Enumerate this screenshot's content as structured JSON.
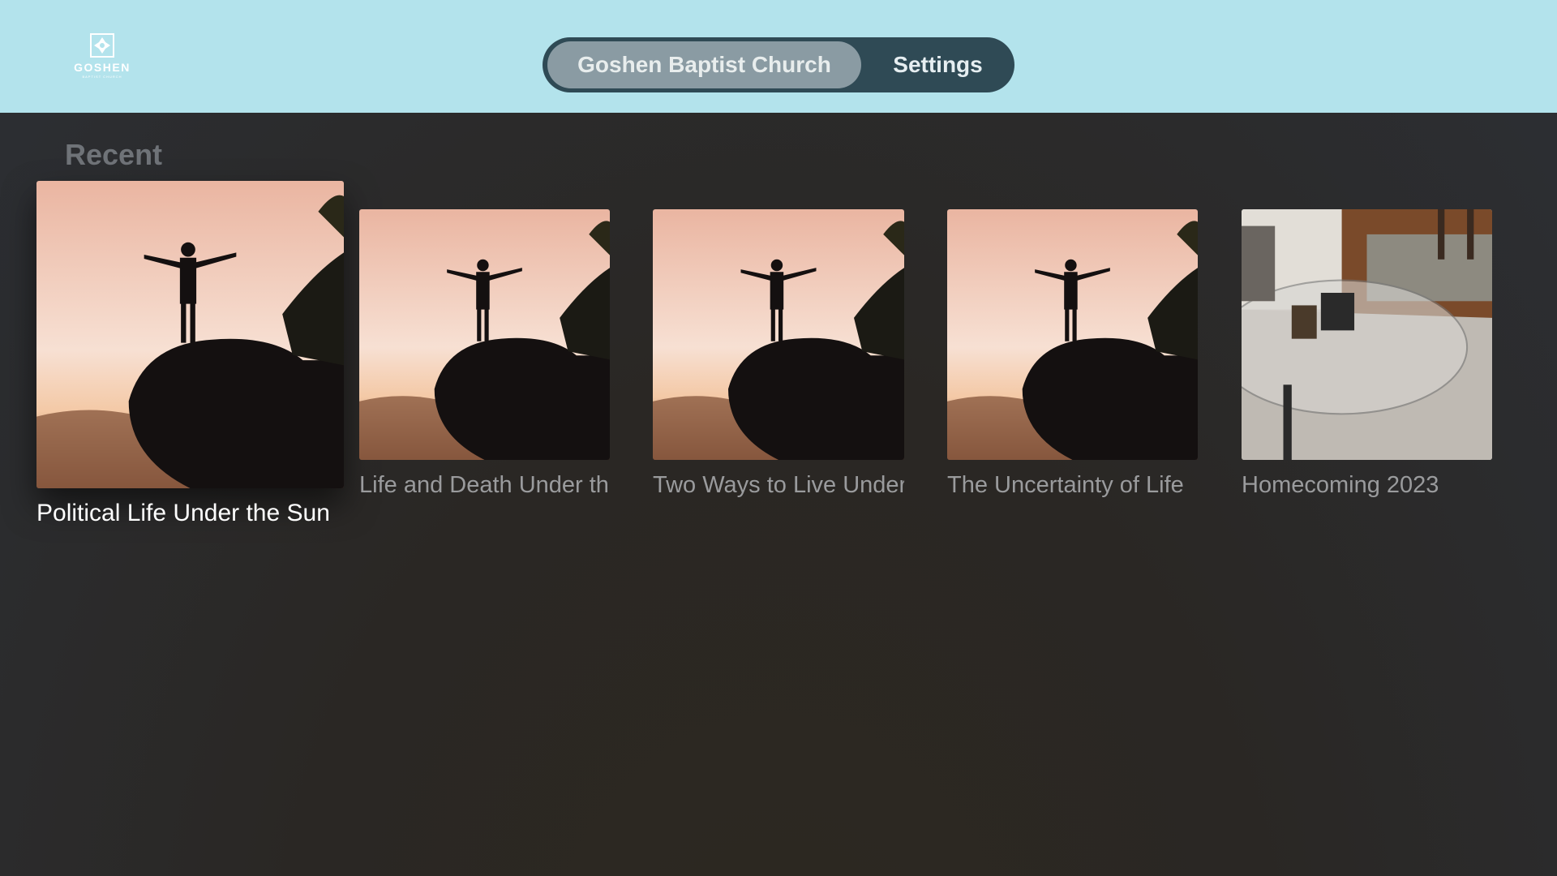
{
  "logo": {
    "text": "GOSHEN",
    "subtext": "BAPTIST CHURCH"
  },
  "tabs": [
    {
      "label": "Goshen Baptist Church",
      "active": true
    },
    {
      "label": "Settings",
      "active": false
    }
  ],
  "section": {
    "title": "Recent"
  },
  "items": [
    {
      "title": "Political Life Under the Sun",
      "thumbnail": "sunrise-silhouette",
      "focused": true
    },
    {
      "title": "Life and Death Under the Sun",
      "thumbnail": "sunrise-silhouette"
    },
    {
      "title": "Two Ways to Live Under the Sun",
      "thumbnail": "sunrise-silhouette"
    },
    {
      "title": "The Uncertainty of Life",
      "thumbnail": "sunrise-silhouette"
    },
    {
      "title": "Homecoming 2023",
      "thumbnail": "living-room-table"
    }
  ],
  "colors": {
    "topbar": "#b3e3ec",
    "tabbar": "#2f4a55",
    "active_tab": "#8a9ba3"
  }
}
